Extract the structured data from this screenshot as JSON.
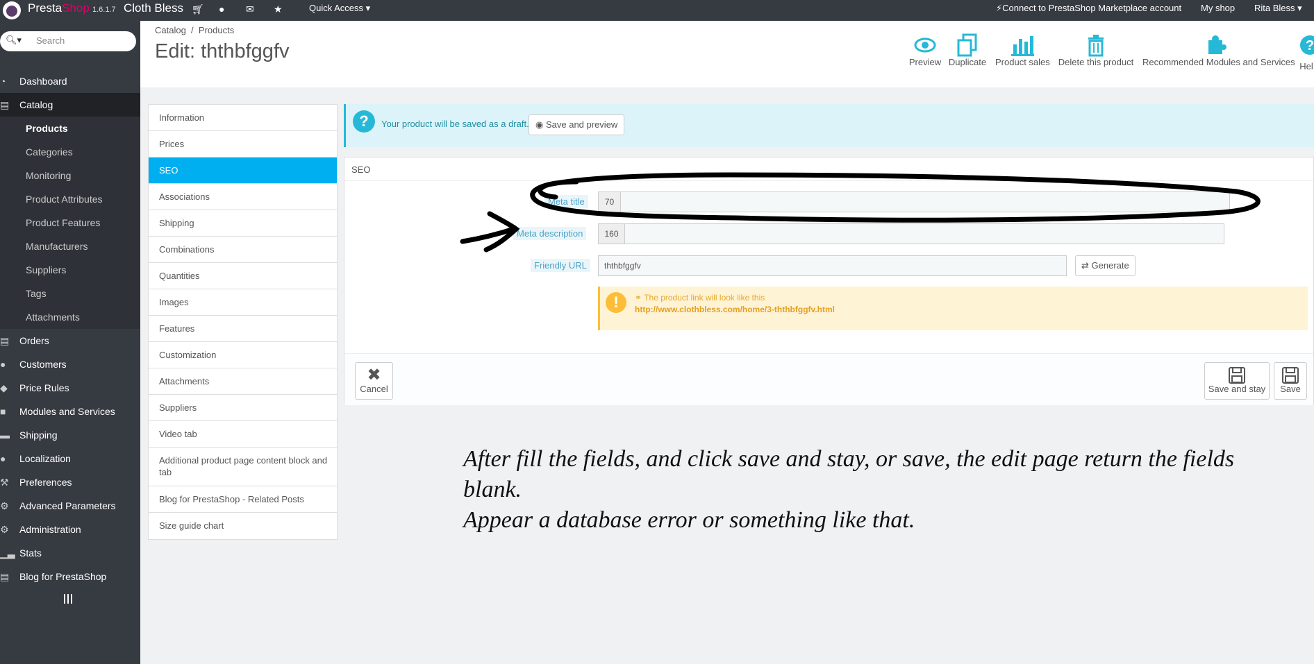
{
  "topbar": {
    "brand_a": "Presta",
    "brand_b": "Shop",
    "version": "1.6.1.7",
    "store_name": "Cloth Bless",
    "quick_access": "Quick Access",
    "connect": "Connect to PrestaShop Marketplace account",
    "my_shop": "My shop",
    "user": "Rita Bless"
  },
  "search": {
    "placeholder": "Search"
  },
  "sidebar": {
    "items": [
      "Dashboard",
      "Catalog",
      "Orders",
      "Customers",
      "Price Rules",
      "Modules and Services",
      "Shipping",
      "Localization",
      "Preferences",
      "Advanced Parameters",
      "Administration",
      "Stats",
      "Blog for PrestaShop"
    ],
    "subitems": [
      "Products",
      "Categories",
      "Monitoring",
      "Product Attributes",
      "Product Features",
      "Manufacturers",
      "Suppliers",
      "Tags",
      "Attachments"
    ]
  },
  "breadcrumb": {
    "a": "Catalog",
    "sep": "/",
    "b": "Products"
  },
  "page_title": "Edit: ththbfggfv",
  "toolbar": {
    "preview": "Preview",
    "duplicate": "Duplicate",
    "sales": "Product sales",
    "delete": "Delete this product",
    "recommended": "Recommended Modules and Services",
    "help": "Hel"
  },
  "tabs": [
    "Information",
    "Prices",
    "SEO",
    "Associations",
    "Shipping",
    "Combinations",
    "Quantities",
    "Images",
    "Features",
    "Customization",
    "Attachments",
    "Suppliers",
    "Video tab",
    "Additional product page content block and tab",
    "Blog for PrestaShop - Related Posts",
    "Size guide chart"
  ],
  "draft": {
    "text": "Your product will be saved as a draft.",
    "button": "Save and preview"
  },
  "seo": {
    "heading": "SEO",
    "meta_title_label": "Meta title",
    "meta_title_count": "70",
    "meta_desc_label": "Meta description",
    "meta_desc_count": "160",
    "url_label": "Friendly URL",
    "url_value": "ththbfggfv",
    "generate": "Generate",
    "link_note": "The product link will look like this",
    "link_url": "http://www.clothbless.com/home/3-ththbfggfv.html"
  },
  "footer": {
    "cancel": "Cancel",
    "save_stay": "Save and stay",
    "save": "Save"
  },
  "annotation": {
    "line1": "After fill the fields, and click save and stay, or save, the edit page return the fields",
    "line2": "blank.",
    "line3": "Appear a database error or something like that."
  },
  "colors": {
    "sidebar": "#363a41",
    "accent": "#00aff0",
    "info": "#25b9d7",
    "warning": "#fcbe39"
  }
}
